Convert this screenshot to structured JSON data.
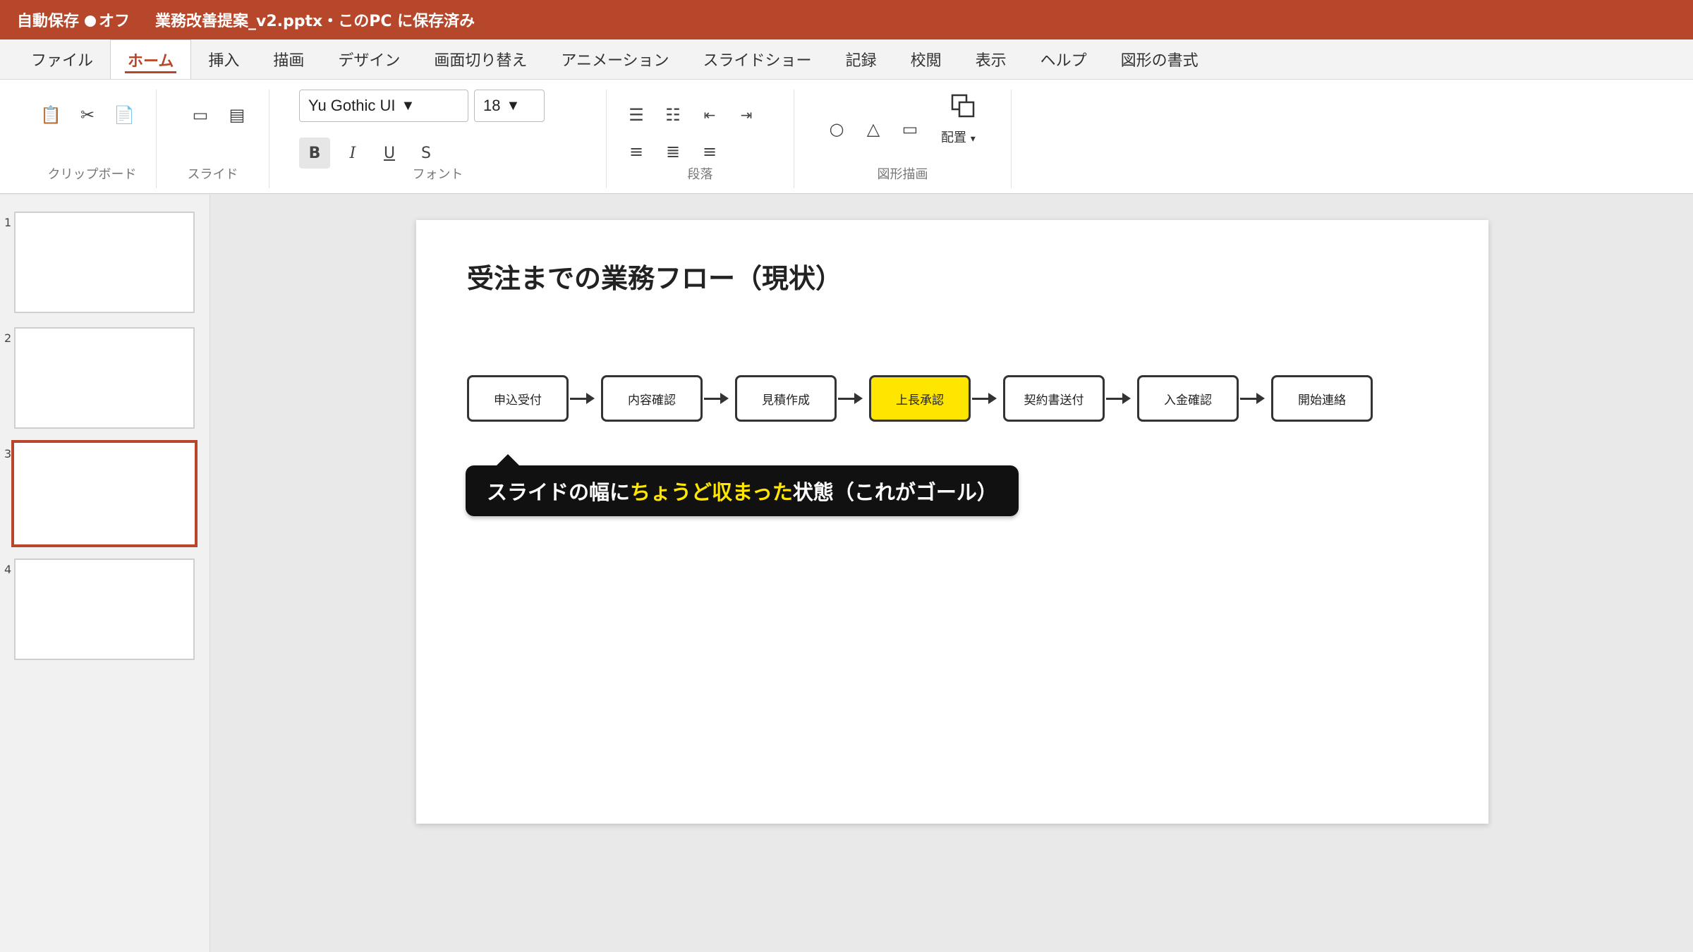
{
  "titlebar": {
    "autosave_label": "自動保存",
    "autosave_state": "オフ",
    "document_title": "業務改善提案_v2.pptx・このPC に保存済み"
  },
  "tabs": [
    "ファイル",
    "ホーム",
    "挿入",
    "描画",
    "デザイン",
    "画面切り替え",
    "アニメーション",
    "スライドショー",
    "記録",
    "校閲",
    "表示",
    "ヘルプ",
    "図形の書式"
  ],
  "active_tab": "ホーム",
  "ribbon": {
    "groups": {
      "clipboard": "クリップボード",
      "slides": "スライド",
      "font": "フォント",
      "paragraph": "段落",
      "drawing": "図形描画"
    },
    "font_name": "Yu Gothic UI",
    "font_size": "18",
    "bold": "B",
    "italic": "I",
    "underline": "U",
    "strike": "S",
    "arrange_label": "配置",
    "icons": {
      "paste": "📋",
      "cut": "✂",
      "copy": "📄",
      "new_slide": "▭",
      "layout": "▤",
      "bullets": "☰",
      "numbering": "☷",
      "outdent": "⇤",
      "indent": "⇥",
      "align_left": "≡",
      "align_center": "≣",
      "align_right": "≡",
      "circle": "○",
      "triangle": "△",
      "rectangle": "▭",
      "dropdown": "▾",
      "caret": "▼"
    }
  },
  "thumbnails": [
    "1",
    "2",
    "3",
    "4"
  ],
  "selected_slide": 3,
  "slide": {
    "title": "受注までの業務フロー（現状）",
    "steps": [
      "申込受付",
      "内容確認",
      "見積作成",
      "上長承認",
      "契約書送付",
      "入金確認",
      "開始連絡"
    ],
    "highlighted_step": "上長承認",
    "callout": {
      "part1": "スライドの幅に",
      "highlight": "ちょうど収まった",
      "part2": "状態（これがゴール）"
    }
  },
  "colors": {
    "accent": "#b7472a",
    "highlight": "#ffe600",
    "callout_bg": "#111111"
  }
}
